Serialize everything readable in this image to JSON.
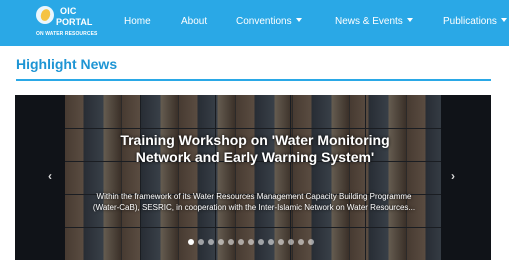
{
  "logo": {
    "line1": "OIC",
    "line2": "PORTAL",
    "line3": "ON WATER RESOURCES"
  },
  "nav": {
    "items": [
      {
        "label": "Home"
      },
      {
        "label": "About"
      },
      {
        "label": "Conventions"
      },
      {
        "label": "News & Events"
      },
      {
        "label": "Publications"
      }
    ]
  },
  "section": {
    "title": "Highlight News"
  },
  "carousel": {
    "title": "Training Workshop on 'Water Monitoring Network and Early Warning System'",
    "caption": "Within the framework of its Water Resources Management Capacity Building Programme (Water-CaB), SESRIC, in cooperation with the Inter-Islamic Network on Water Resources...",
    "prev_icon": "‹",
    "next_icon": "›",
    "slide_count": 13,
    "active_index": 0
  },
  "colors": {
    "nav_bg": "#2aa8e6",
    "title": "#1e95d4"
  }
}
